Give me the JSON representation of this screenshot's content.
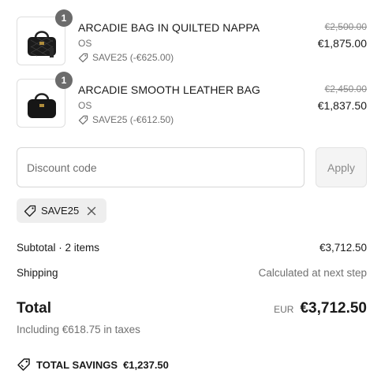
{
  "items": [
    {
      "quantity": "1",
      "name": "ARCADIE BAG IN QUILTED NAPPA",
      "variant": "OS",
      "discount": "SAVE25 (-€625.00)",
      "original_price": "€2,500.00",
      "price": "€1,875.00"
    },
    {
      "quantity": "1",
      "name": "ARCADIE SMOOTH LEATHER BAG",
      "variant": "OS",
      "discount": "SAVE25 (-€612.50)",
      "original_price": "€2,450.00",
      "price": "€1,837.50"
    }
  ],
  "discount": {
    "placeholder": "Discount code",
    "apply_label": "Apply",
    "applied_code": "SAVE25"
  },
  "summary": {
    "subtotal_label": "Subtotal · 2 items",
    "subtotal_value": "€3,712.50",
    "shipping_label": "Shipping",
    "shipping_value": "Calculated at next step",
    "total_label": "Total",
    "total_currency": "EUR",
    "total_value": "€3,712.50",
    "taxes_note": "Including €618.75 in taxes",
    "savings_label": "TOTAL SAVINGS",
    "savings_value": "€1,237.50"
  },
  "icons": {
    "tag": "tag-icon",
    "close": "close-icon",
    "bag": "handbag-image"
  },
  "colors": {
    "text": "#1a1a1a",
    "muted": "#707070",
    "badge": "#6b6b6b",
    "chip_bg": "#eeeeee",
    "apply_bg": "#f4f4f4"
  }
}
